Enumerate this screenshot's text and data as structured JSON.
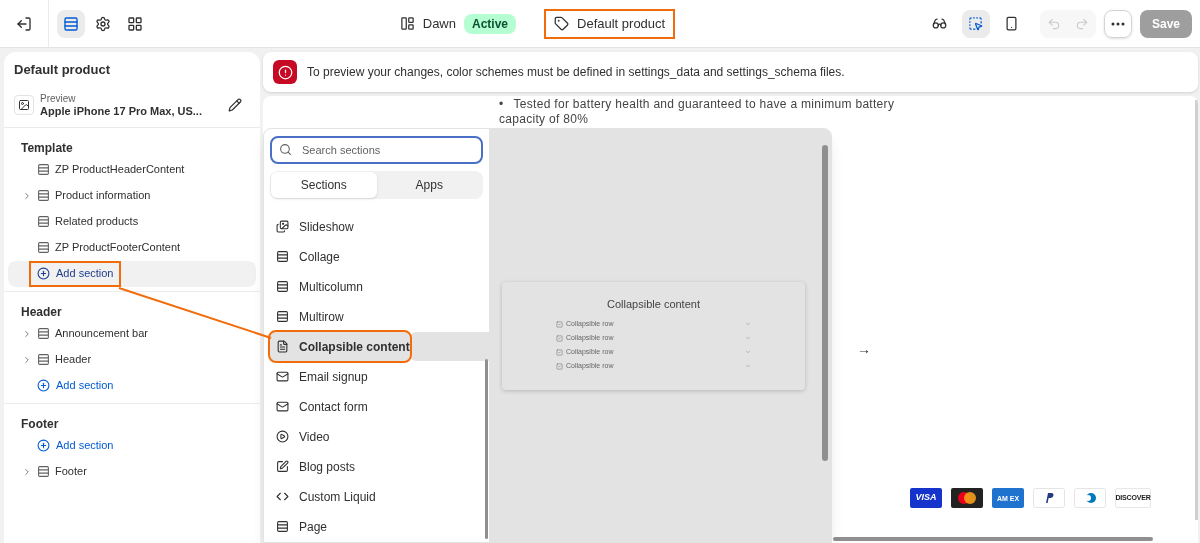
{
  "topbar": {
    "nav": [
      {
        "kind": "sections",
        "selected": true
      },
      {
        "kind": "settings",
        "selected": false
      },
      {
        "kind": "apps",
        "selected": false
      }
    ],
    "theme": {
      "name": "Dawn",
      "badge": "Active"
    },
    "template": {
      "label": "Default product",
      "highlighted": true
    },
    "tools": [
      {
        "kind": "inspect",
        "selected": false
      },
      {
        "kind": "select",
        "selected": true
      },
      {
        "kind": "mobile",
        "selected": false
      }
    ],
    "undo": {
      "disabled": true
    },
    "redo": {
      "disabled": true
    },
    "save": {
      "label": "Save",
      "disabled": true
    }
  },
  "sidebar": {
    "title": "Default product",
    "preview": {
      "label": "Preview",
      "value": "Apple iPhone 17 Pro Max, US..."
    },
    "groups": [
      {
        "title": "Template",
        "items": [
          {
            "kind": "section",
            "label": "ZP ProductHeaderContent",
            "has_children": false
          },
          {
            "kind": "section",
            "label": "Product information",
            "has_children": true
          },
          {
            "kind": "section",
            "label": "Related products",
            "has_children": false
          },
          {
            "kind": "section",
            "label": "ZP ProductFooterContent",
            "has_children": false
          },
          {
            "kind": "add",
            "label": "Add section",
            "highlighted": true
          }
        ]
      },
      {
        "title": "Header",
        "items": [
          {
            "kind": "section",
            "label": "Announcement bar",
            "has_children": true
          },
          {
            "kind": "section",
            "label": "Header",
            "has_children": true
          },
          {
            "kind": "add",
            "label": "Add section",
            "highlighted": false
          }
        ]
      },
      {
        "title": "Footer",
        "items": [
          {
            "kind": "add",
            "label": "Add section",
            "highlighted": false
          },
          {
            "kind": "section",
            "label": "Footer",
            "has_children": true
          }
        ]
      }
    ]
  },
  "banner": {
    "text": "To preview your changes, color schemes must be defined in settings_data and settings_schema files."
  },
  "preview": {
    "bullet": "•",
    "lines": [
      "Tested for battery health and guaranteed to have a minimum battery",
      "capacity of 80%"
    ],
    "arrow": "→",
    "payments": [
      {
        "kind": "visa",
        "label": "VISA"
      },
      {
        "kind": "mastercard"
      },
      {
        "kind": "amex",
        "label": "AM EX"
      },
      {
        "kind": "paypal"
      },
      {
        "kind": "diners"
      },
      {
        "kind": "discover",
        "label": "DISCOVER"
      }
    ]
  },
  "picker": {
    "search": {
      "placeholder": "Search sections"
    },
    "tabs": [
      {
        "label": "Sections",
        "selected": true
      },
      {
        "label": "Apps",
        "selected": false
      }
    ],
    "items": [
      {
        "kind": "image",
        "label": "Slideshow",
        "selected": false
      },
      {
        "kind": "section",
        "label": "Collage",
        "selected": false
      },
      {
        "kind": "section",
        "label": "Multicolumn",
        "selected": false
      },
      {
        "kind": "section",
        "label": "Multirow",
        "selected": false
      },
      {
        "kind": "text",
        "label": "Collapsible content",
        "selected": true
      },
      {
        "kind": "email",
        "label": "Email signup",
        "selected": false
      },
      {
        "kind": "email",
        "label": "Contact form",
        "selected": false
      },
      {
        "kind": "video",
        "label": "Video",
        "selected": false
      },
      {
        "kind": "blog",
        "label": "Blog posts",
        "selected": false
      },
      {
        "kind": "code",
        "label": "Custom Liquid",
        "selected": false
      },
      {
        "kind": "section",
        "label": "Page",
        "selected": false
      }
    ],
    "card": {
      "title": "Collapsible content",
      "rows": [
        "Collapsible row",
        "Collapsible row",
        "Collapsible row",
        "Collapsible row"
      ]
    }
  }
}
